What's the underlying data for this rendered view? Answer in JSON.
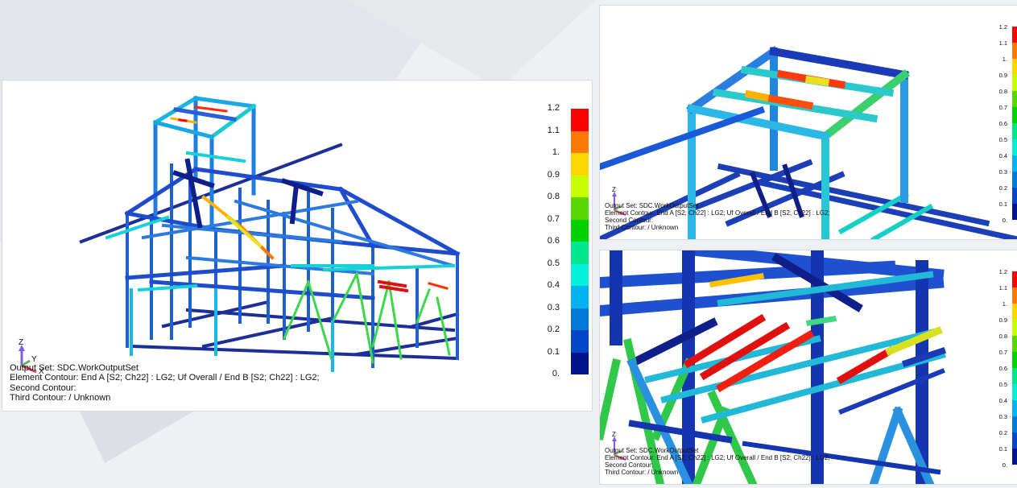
{
  "legend": {
    "ticks": [
      "1.2",
      "1.1",
      "1.",
      "0.9",
      "0.8",
      "0.7",
      "0.6",
      "0.5",
      "0.4",
      "0.3",
      "0.2",
      "0.1",
      "0."
    ],
    "colors": [
      "#ff0000",
      "#ff7800",
      "#ffd700",
      "#c8ff00",
      "#5ad700",
      "#00d200",
      "#00e68c",
      "#00f0dc",
      "#00b4f0",
      "#0078d7",
      "#0046c8",
      "#00148c"
    ]
  },
  "triad": {
    "x": "X",
    "y": "Y",
    "z": "Z"
  },
  "viewports": [
    {
      "info": {
        "output_set": "Output Set: SDC.WorkOutputSet",
        "element_contour": "Element Contour: End A [S2; Ch22] : LG2; Uf Overall / End B [S2; Ch22] : LG2;",
        "second_contour": "Second Contour:",
        "third_contour": "Third Contour:  / Unknown"
      }
    },
    {
      "info": {
        "output_set": "Output Set: SDC.WorkOutputSet",
        "element_contour": "Element Contour: End A [S2; Ch22] : LG2; Uf Overall / End B [S2; Ch22] : LG2;",
        "second_contour": "Second Contour:",
        "third_contour": "Third Contour:  / Unknown"
      }
    },
    {
      "info": {
        "output_set": "Output Set: SDC.WorkOutputSet",
        "element_contour": "Element Contour: End A [S2; Ch22] : LG2; Uf Overall / End B [S2; Ch22] : LG2;",
        "second_contour": "Second Contour:",
        "third_contour": "Third Contour:  / Unknown"
      }
    }
  ]
}
